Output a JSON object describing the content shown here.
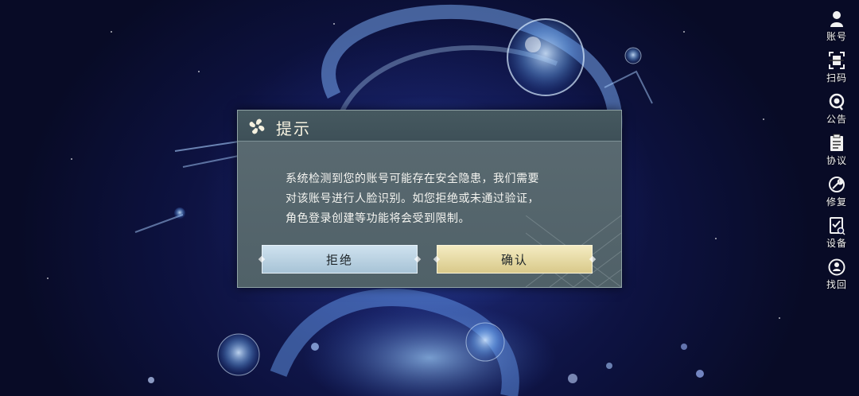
{
  "sidebar": {
    "items": [
      {
        "label": "账号",
        "icon": "account-icon"
      },
      {
        "label": "扫码",
        "icon": "scan-icon"
      },
      {
        "label": "公告",
        "icon": "announcement-icon"
      },
      {
        "label": "协议",
        "icon": "agreement-icon"
      },
      {
        "label": "修复",
        "icon": "repair-icon"
      },
      {
        "label": "设备",
        "icon": "device-icon"
      },
      {
        "label": "找回",
        "icon": "recover-icon"
      }
    ]
  },
  "dialog": {
    "title": "提示",
    "message_lines": [
      "系统检测到您的账号可能存在安全隐患，我们需要",
      "对该账号进行人脸识别。如您拒绝或未通过验证，",
      "角色登录创建等功能将会受到限制。"
    ],
    "reject_label": "拒绝",
    "confirm_label": "确认"
  },
  "colors": {
    "dialog_bg": "#56676d",
    "reject_button": "#b9d2e3",
    "confirm_button": "#e8dba4",
    "background": "#0d1240"
  }
}
